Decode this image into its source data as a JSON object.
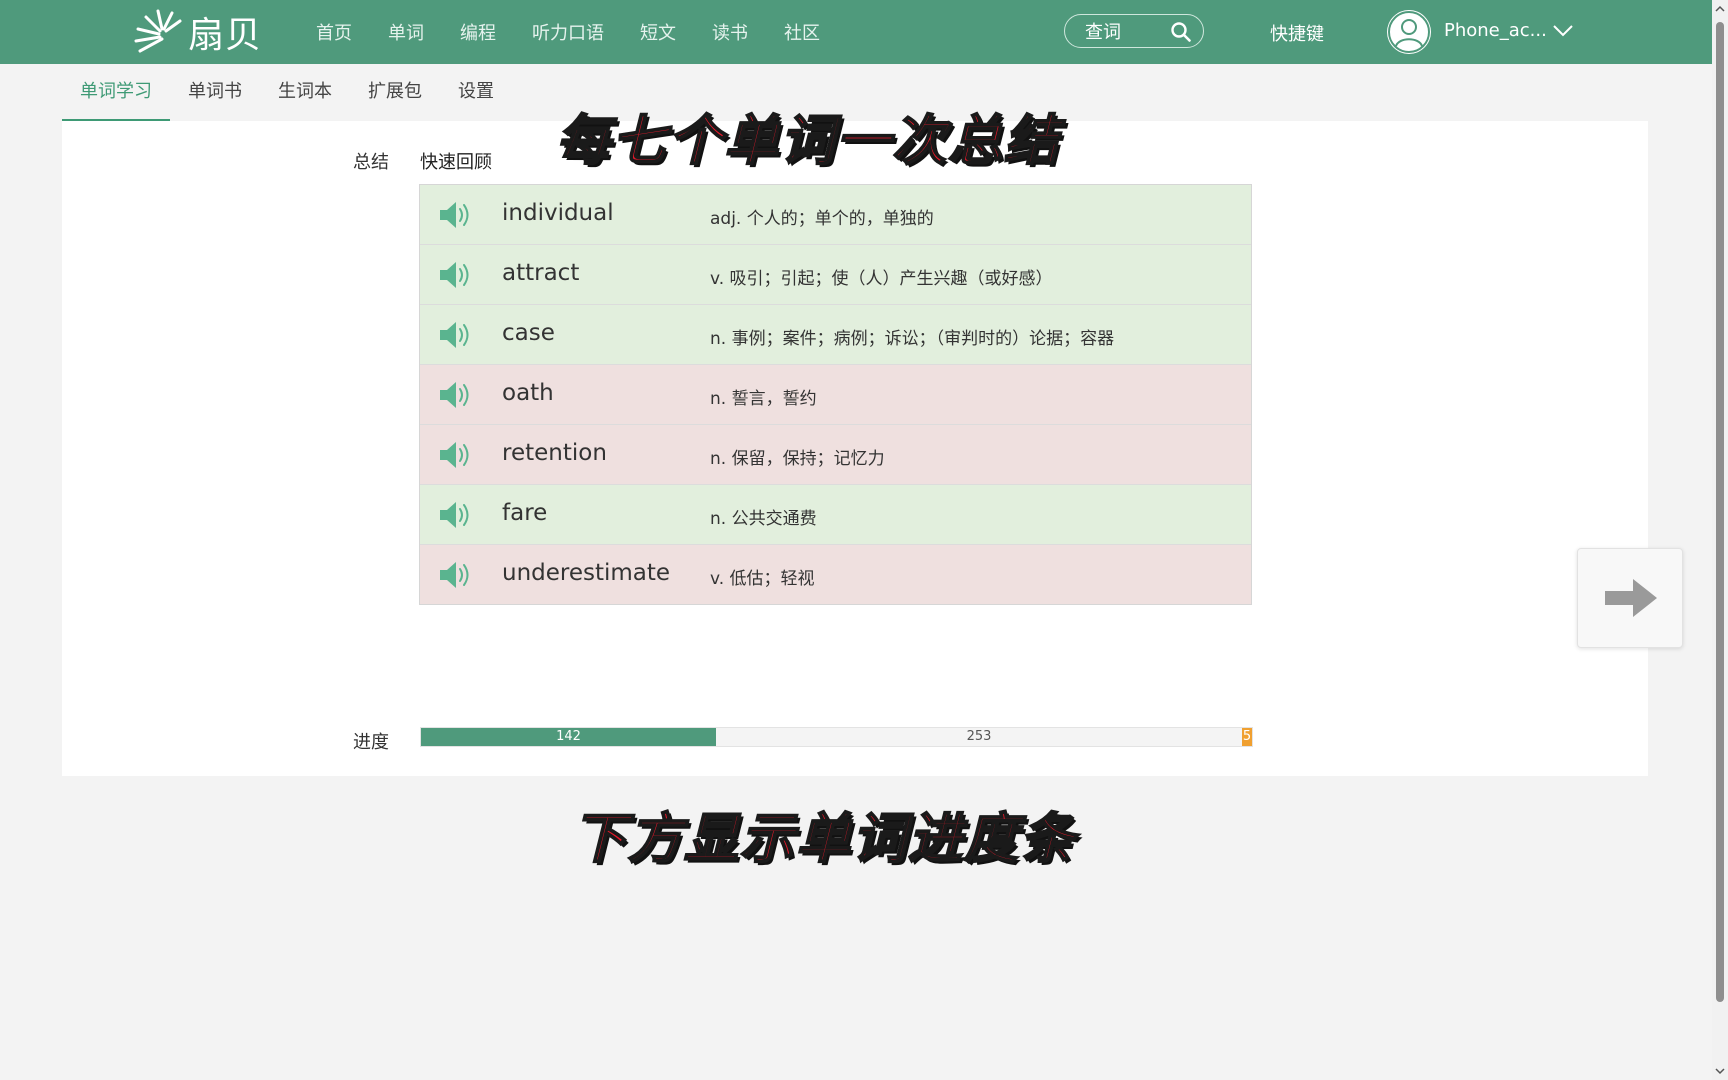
{
  "header": {
    "logo_text": "扇贝",
    "nav": [
      "首页",
      "单词",
      "编程",
      "听力口语",
      "短文",
      "读书",
      "社区"
    ],
    "search_placeholder": "查词",
    "shortcut_label": "快捷键",
    "username": "Phone_ac..."
  },
  "subtabs": [
    "单词学习",
    "单词书",
    "生词本",
    "扩展包",
    "设置"
  ],
  "active_subtab": "单词学习",
  "summary": {
    "label": "总结",
    "title": "快速回顾",
    "words": [
      {
        "word": "individual",
        "definition": "adj. 个人的；单个的，单独的",
        "status": "known"
      },
      {
        "word": "attract",
        "definition": "v. 吸引；引起；使（人）产生兴趣（或好感）",
        "status": "known"
      },
      {
        "word": "case",
        "definition": "n. 事例；案件；病例；诉讼；（审判时的）论据；容器",
        "status": "known"
      },
      {
        "word": "oath",
        "definition": "n. 誓言，誓约",
        "status": "unknown"
      },
      {
        "word": "retention",
        "definition": "n. 保留，保持；记忆力",
        "status": "unknown"
      },
      {
        "word": "fare",
        "definition": "n. 公共交通费",
        "status": "known"
      },
      {
        "word": "underestimate",
        "definition": "v. 低估；轻视",
        "status": "unknown"
      }
    ]
  },
  "progress": {
    "label": "进度",
    "learned": 142,
    "remaining": 253,
    "extra": 5
  },
  "captions": {
    "top": "每七个单词一次总结",
    "bottom": "下方显示单词进度条"
  },
  "colors": {
    "brand": "#4f9a7c",
    "known_row": "#e2efdd",
    "unknown_row": "#efe0df",
    "progress_extra": "#f0a030",
    "caption_red": "#e8182a"
  }
}
